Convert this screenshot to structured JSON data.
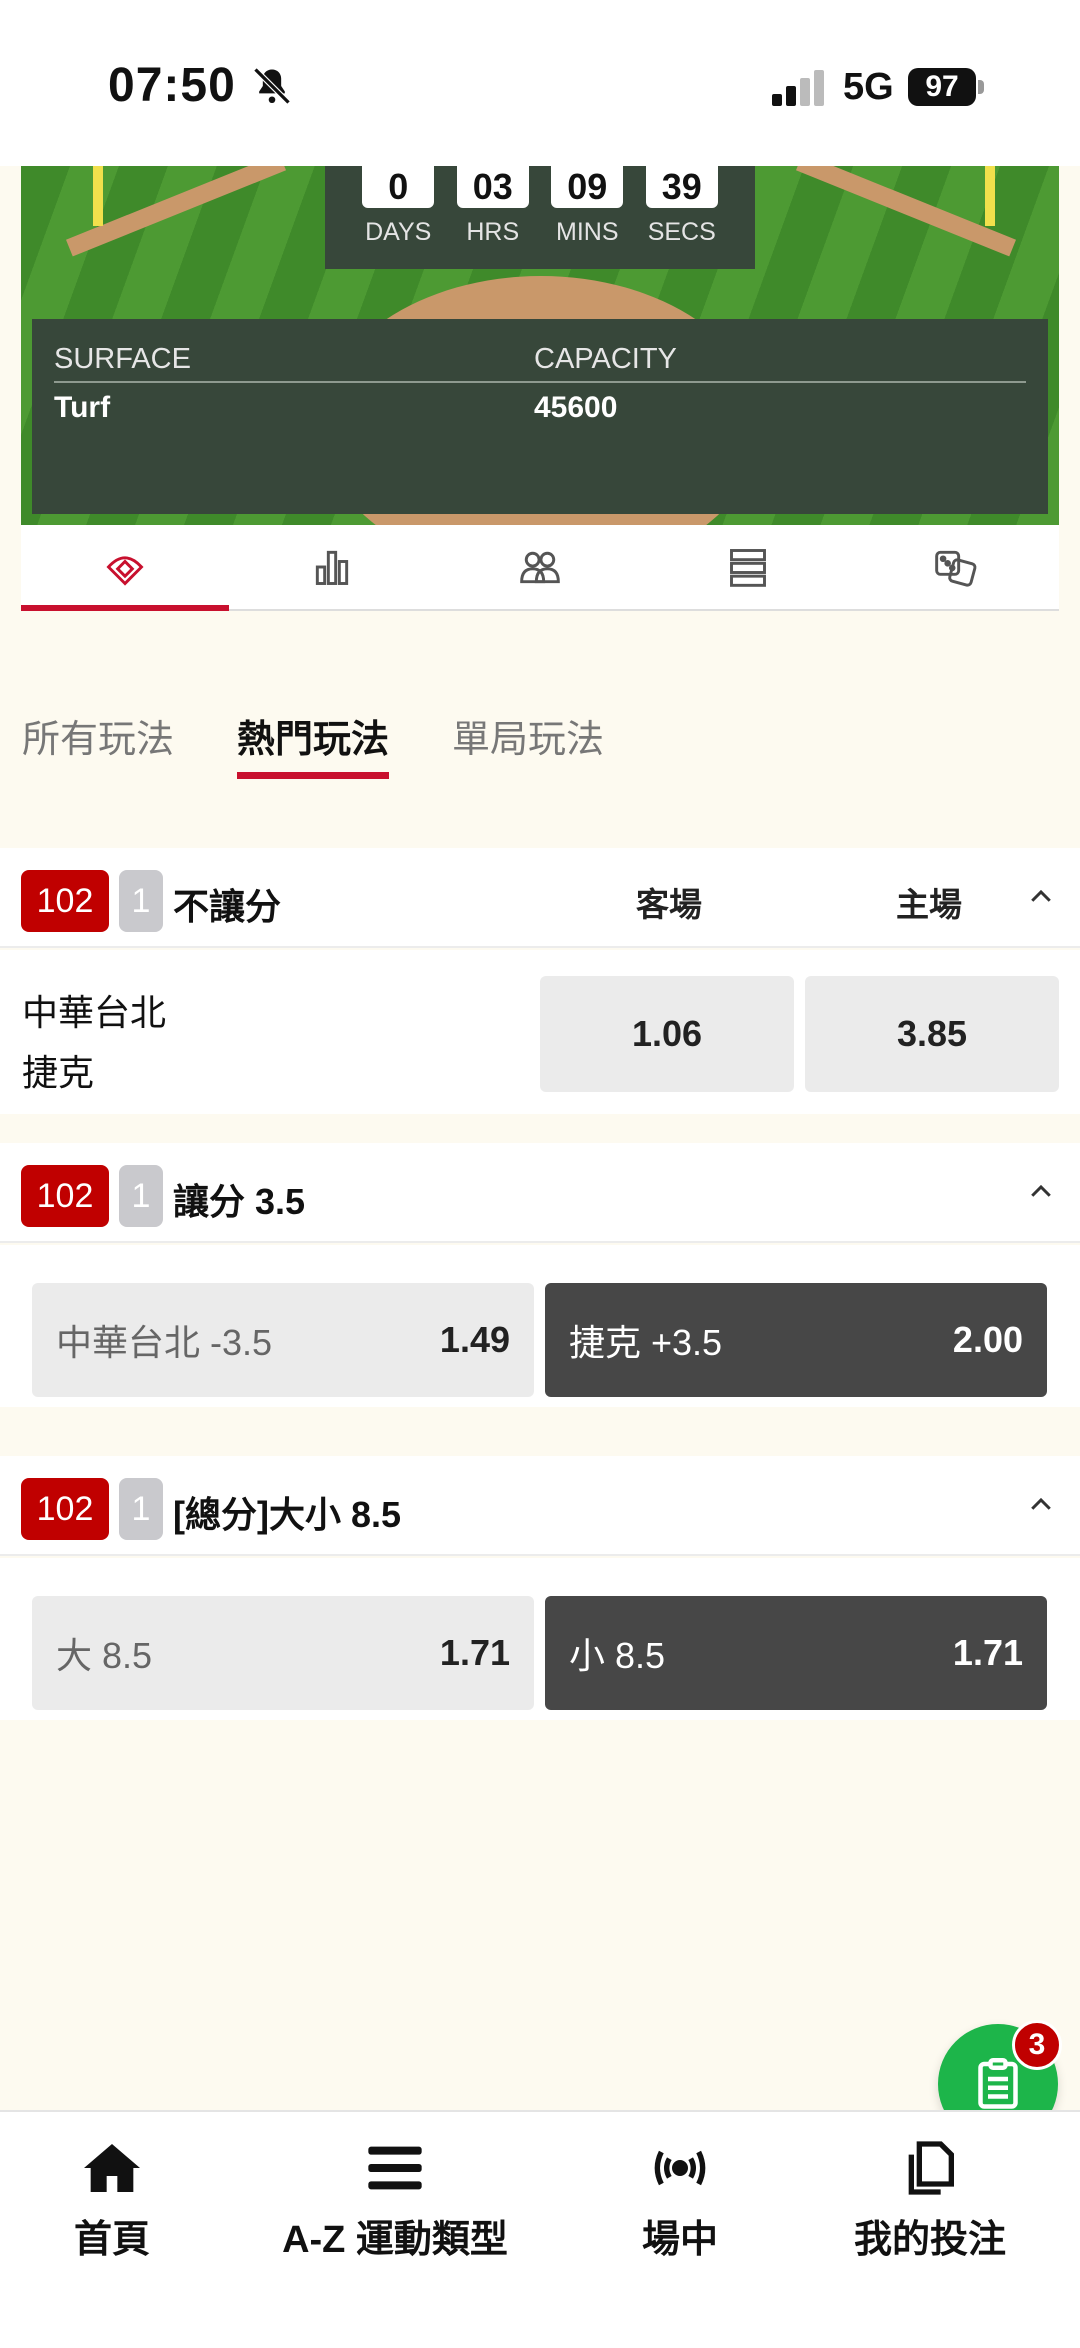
{
  "status_bar": {
    "time": "07:50",
    "network": "5G",
    "battery": "97"
  },
  "countdown": [
    {
      "value": "0",
      "label": "DAYS"
    },
    {
      "value": "03",
      "label": "HRS"
    },
    {
      "value": "09",
      "label": "MINS"
    },
    {
      "value": "39",
      "label": "SECS"
    }
  ],
  "venue": {
    "surface_label": "SURFACE",
    "capacity_label": "CAPACITY",
    "surface_value": "Turf",
    "capacity_value": "45600"
  },
  "icon_tabs": [
    "baseball-field-icon",
    "stats-bar-chart-icon",
    "players-icon",
    "list-icon",
    "dice-icon"
  ],
  "market_tabs": [
    {
      "label": "所有玩法",
      "active": false
    },
    {
      "label": "熱門玩法",
      "active": true
    },
    {
      "label": "單局玩法",
      "active": false
    }
  ],
  "markets": {
    "moneyline": {
      "event_no": "102",
      "period": "1",
      "title": "不讓分",
      "away_header": "客場",
      "home_header": "主場",
      "team1": "中華台北",
      "team2": "捷克",
      "away_odds": "1.06",
      "home_odds": "3.85"
    },
    "handicap": {
      "event_no": "102",
      "period": "1",
      "title": "讓分 3.5",
      "left_label": "中華台北 -3.5",
      "left_odds": "1.49",
      "right_label": "捷克 +3.5",
      "right_odds": "2.00"
    },
    "total": {
      "event_no": "102",
      "period": "1",
      "title": "[總分]大小 8.5",
      "left_label": "大 8.5",
      "left_odds": "1.71",
      "right_label": "小 8.5",
      "right_odds": "1.71"
    }
  },
  "betslip": {
    "count": "3"
  },
  "bottom_nav": {
    "home": "首頁",
    "sports": "A-Z 運動類型",
    "live": "場中",
    "my_bets": "我的投注"
  },
  "colors": {
    "accent": "#c8102e",
    "badge": "#c00000",
    "betslip_green": "#1db54a"
  }
}
